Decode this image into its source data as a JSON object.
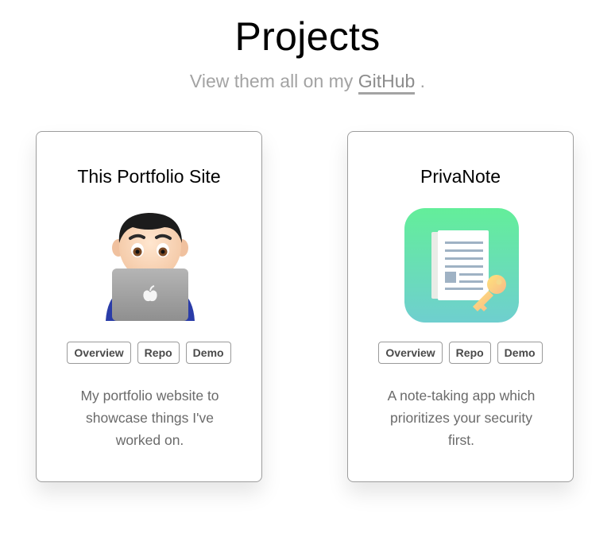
{
  "header": {
    "title": "Projects",
    "subtitle_prefix": "View them all on my ",
    "subtitle_link": "GitHub",
    "subtitle_suffix": " ."
  },
  "projects": [
    {
      "title": "This Portfolio Site",
      "image_icon": "man-technologist-icon",
      "buttons": [
        "Overview",
        "Repo",
        "Demo"
      ],
      "description": "My portfolio website to showcase things I've worked on."
    },
    {
      "title": "PrivaNote",
      "image_icon": "privanote-app-icon",
      "buttons": [
        "Overview",
        "Repo",
        "Demo"
      ],
      "description": "A note-taking app which prioritizes your security first."
    }
  ],
  "colors": {
    "card_border": "#9d9d9d",
    "subtitle": "#a3a3a3",
    "description": "#6a6a6a",
    "privanote_gradient_top": "#63ee9a",
    "privanote_gradient_bottom": "#6fcfcf"
  }
}
